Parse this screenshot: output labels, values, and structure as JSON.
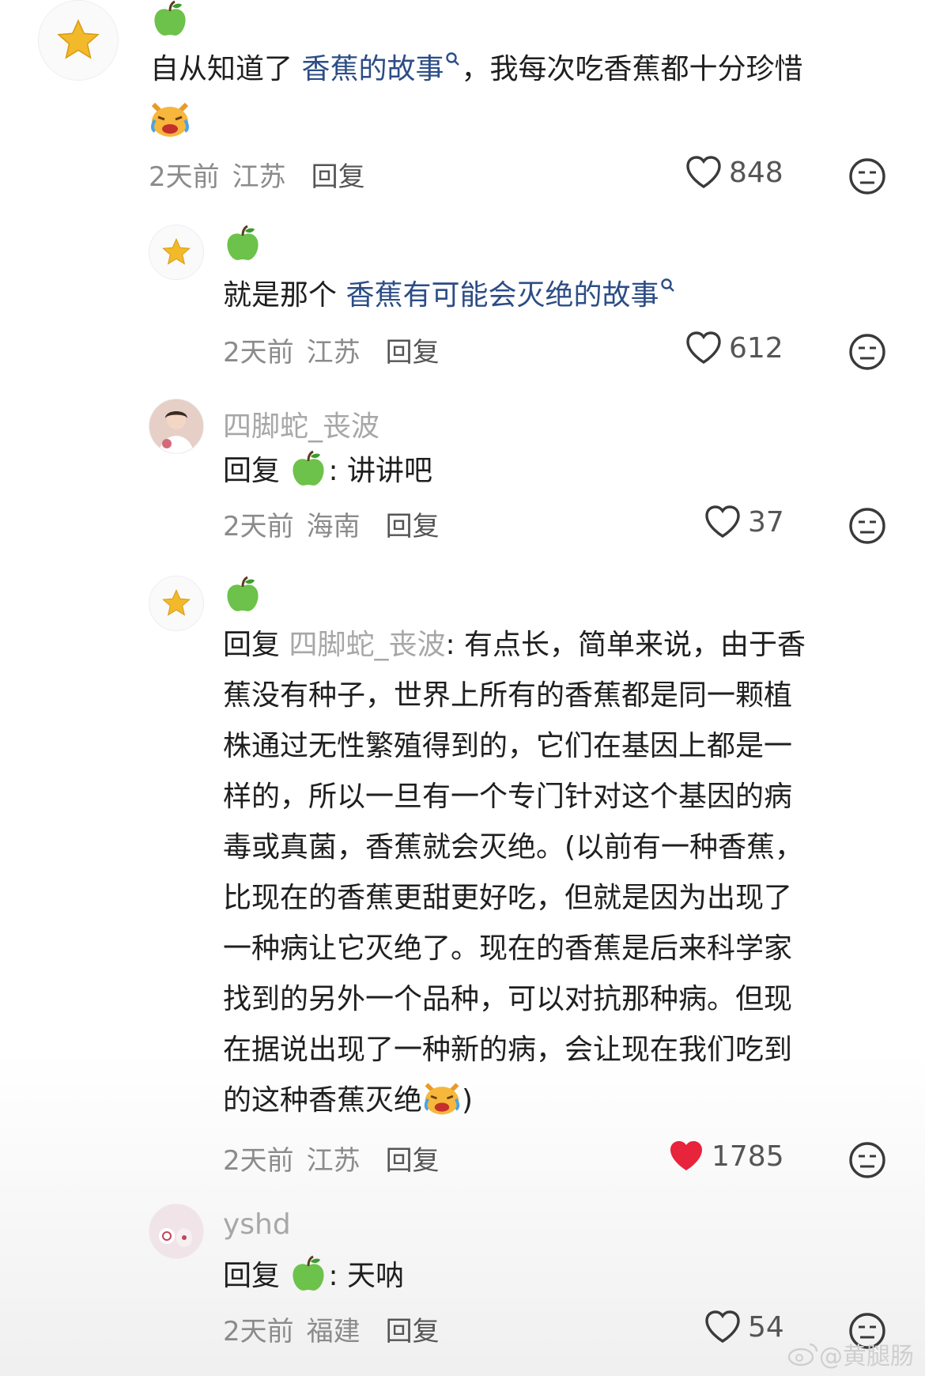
{
  "comments": [
    {
      "id": "c1",
      "text_before": "自从知道了 ",
      "link": "香蕉的故事",
      "text_after": "，我每次吃香蕉都十分珍惜",
      "time": "2天前",
      "location": "江苏",
      "reply_label": "回复",
      "likes": "848"
    },
    {
      "id": "c2",
      "text_before": "就是那个 ",
      "link": "香蕉有可能会灭绝的故事",
      "time": "2天前",
      "location": "江苏",
      "reply_label": "回复",
      "likes": "612"
    },
    {
      "id": "c3",
      "username": "四脚蛇_丧波",
      "reply_prefix": "回复",
      "text": ": 讲讲吧",
      "time": "2天前",
      "location": "海南",
      "reply_label": "回复",
      "likes": "37"
    },
    {
      "id": "c4",
      "reply_prefix": "回复",
      "reply_to": "四脚蛇_丧波",
      "lines": [
        ": 有点长，简单来说，由于香",
        "蕉没有种子，世界上所有的香蕉都是同一颗植",
        "株通过无性繁殖得到的，它们在基因上都是一",
        "样的，所以一旦有一个专门针对这个基因的病",
        "毒或真菌，香蕉就会灭绝。(以前有一种香蕉，",
        "比现在的香蕉更甜更好吃，但就是因为出现了",
        "一种病让它灭绝了。现在的香蕉是后来科学家",
        "找到的另外一个品种，可以对抗那种病。但现",
        "在据说出现了一种新的病，会让现在我们吃到",
        "的这种香蕉灭绝"
      ],
      "line_end": ")",
      "time": "2天前",
      "location": "江苏",
      "reply_label": "回复",
      "likes": "1785",
      "liked": true
    },
    {
      "id": "c5",
      "username": "yshd",
      "reply_prefix": "回复",
      "text": ": 天呐",
      "time": "2天前",
      "location": "福建",
      "reply_label": "回复",
      "likes": "54"
    }
  ],
  "watermark": "@黄腿肠",
  "colors": {
    "link": "#2c4d86",
    "liked_heart": "#e8233c",
    "meta": "#8b8b8b",
    "username": "#a7a7a7"
  },
  "icons": [
    "star-avatar-icon",
    "green-apple-icon",
    "crying-cat-emoji",
    "heart-icon",
    "dislike-face-icon",
    "search-icon"
  ]
}
